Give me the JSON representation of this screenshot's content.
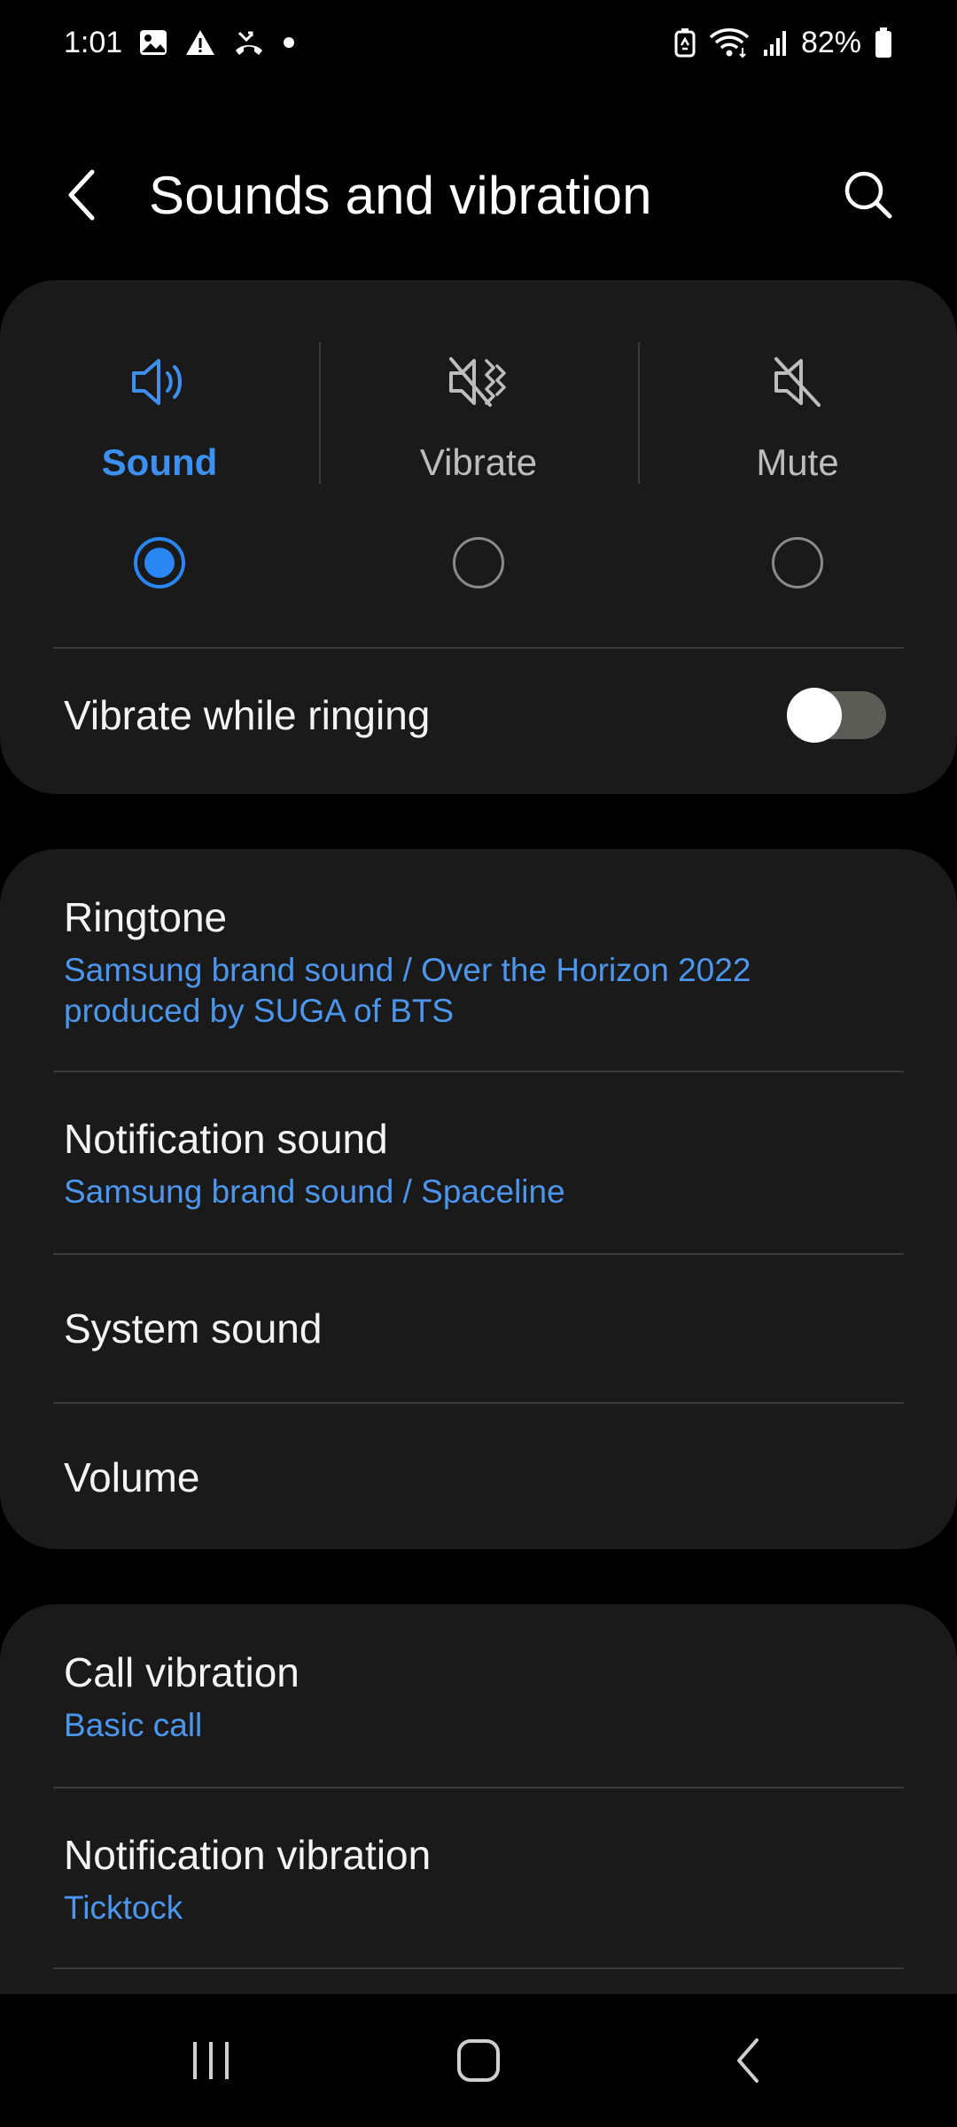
{
  "status_bar": {
    "time": "1:01",
    "left_icons": [
      "gallery-icon",
      "warning-icon",
      "missed-call-icon",
      "dot-icon"
    ],
    "right_icons": [
      "battery-saver-icon",
      "wifi-icon",
      "signal-icon",
      "battery-icon"
    ],
    "battery_percent": "82%"
  },
  "header": {
    "title": "Sounds and vibration",
    "back_icon": "back-arrow-icon",
    "search_icon": "search-icon"
  },
  "sound_modes": {
    "options": [
      {
        "label": "Sound",
        "icon": "speaker-icon",
        "selected": true
      },
      {
        "label": "Vibrate",
        "icon": "vibrate-icon",
        "selected": false
      },
      {
        "label": "Mute",
        "icon": "mute-icon",
        "selected": false
      }
    ],
    "vibrate_while_ringing": {
      "label": "Vibrate while ringing",
      "enabled": false
    }
  },
  "sound_settings": {
    "ringtone": {
      "title": "Ringtone",
      "value": "Samsung brand sound / Over the Horizon 2022 produced by SUGA of BTS"
    },
    "notification_sound": {
      "title": "Notification sound",
      "value": "Samsung brand sound / Spaceline"
    },
    "system_sound": {
      "title": "System sound"
    },
    "volume": {
      "title": "Volume"
    }
  },
  "vibration_settings": {
    "call_vibration": {
      "title": "Call vibration",
      "value": "Basic call"
    },
    "notification_vibration": {
      "title": "Notification vibration",
      "value": "Ticktock"
    }
  },
  "colors": {
    "accent": "#3d8ff0",
    "card_background": "#1a1a1a",
    "page_background": "#000000"
  },
  "nav_bar": [
    "recents-icon",
    "home-icon",
    "back-icon"
  ]
}
